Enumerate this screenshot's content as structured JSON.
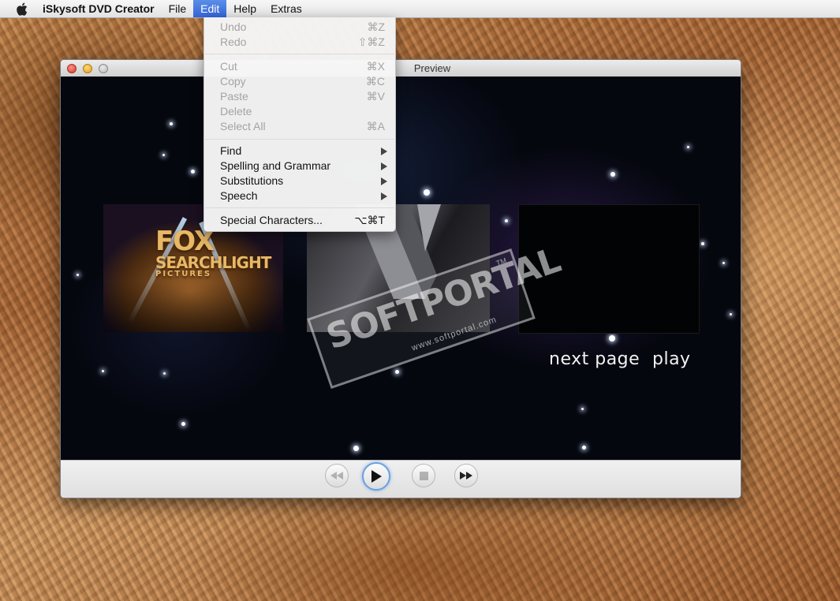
{
  "menubar": {
    "app_name": "iSkysoft DVD Creator",
    "items": [
      "File",
      "Edit",
      "Help",
      "Extras"
    ],
    "active": "Edit"
  },
  "window": {
    "title": "Preview"
  },
  "preview": {
    "links": [
      "next page",
      "play"
    ],
    "watermark": {
      "text": "SOFTPORTAL",
      "url": "www.softportal.com",
      "tm": "TM"
    }
  },
  "edit_menu": {
    "items": [
      {
        "label": "Undo",
        "shortcut": "⌘Z",
        "enabled": false
      },
      {
        "label": "Redo",
        "shortcut": "⇧⌘Z",
        "enabled": false
      },
      {
        "label": "Cut",
        "shortcut": "⌘X",
        "enabled": false
      },
      {
        "label": "Copy",
        "shortcut": "⌘C",
        "enabled": false
      },
      {
        "label": "Paste",
        "shortcut": "⌘V",
        "enabled": false
      },
      {
        "label": "Delete",
        "shortcut": "",
        "enabled": false
      },
      {
        "label": "Select All",
        "shortcut": "⌘A",
        "enabled": false
      },
      {
        "label": "Find",
        "submenu": true,
        "enabled": true
      },
      {
        "label": "Spelling and Grammar",
        "submenu": true,
        "enabled": true
      },
      {
        "label": "Substitutions",
        "submenu": true,
        "enabled": true
      },
      {
        "label": "Speech",
        "submenu": true,
        "enabled": true
      },
      {
        "label": "Special Characters...",
        "shortcut": "⌥⌘T",
        "enabled": true
      }
    ]
  },
  "controls": {
    "icons": [
      "rewind-icon",
      "play-icon",
      "stop-icon",
      "fast-forward-icon"
    ]
  },
  "colors": {
    "menu_highlight": "#3d6fe0",
    "window_chrome": "#e9e9e9",
    "preview_bg": "#05070f"
  }
}
